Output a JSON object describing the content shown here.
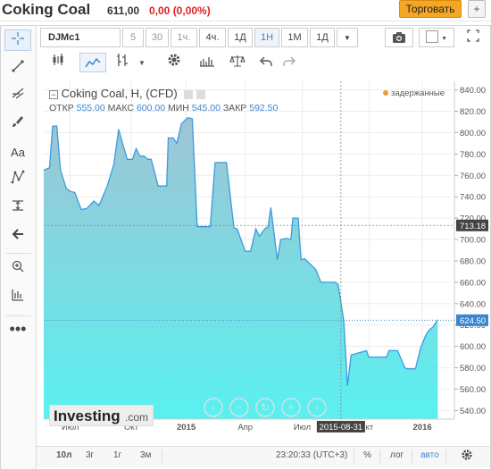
{
  "header": {
    "title": "Coking Coal",
    "price": "611,00",
    "change": "0,00 (0,00%)",
    "trade_label": "Торговать",
    "add_portfolio_label": "+",
    "change_color": "#e0201f"
  },
  "toolbar_top": {
    "symbol": "DJMc1",
    "intervals": [
      "5",
      "30",
      "1ч.",
      "4ч.",
      "1Д",
      "1Н",
      "1М",
      "1Д"
    ],
    "active_interval": "1Н"
  },
  "toolbar_second": {
    "icons": [
      "bars-icon",
      "area-chart-icon",
      "candles-icon",
      "dropdown-icon",
      "gear-icon",
      "indicators-icon",
      "compare-icon",
      "undo-icon",
      "redo-icon"
    ]
  },
  "left_tools": [
    "crosshair-icon",
    "line-tool-icon",
    "fib-tool-icon",
    "brush-icon",
    "text-tool-icon",
    "pattern-tool-icon",
    "measure-tool-icon",
    "arrow-icon",
    "zoom-icon",
    "indicator-tool-icon",
    "more-icon"
  ],
  "left_tool_text": "Aa",
  "chart_info": {
    "name": "Coking Coal, H, (CFD)",
    "open_label": "ОТКР",
    "open": "555.00",
    "high_label": "МАКС",
    "high": "600.00",
    "low_label": "МИН",
    "low": "545.00",
    "close_label": "ЗАКР",
    "close": "592.50",
    "delayed_label": "задержанные"
  },
  "logo": {
    "word": "Investing",
    "suffix": ".com"
  },
  "bottom_bar": {
    "ranges": [
      "10л",
      "3г",
      "1г",
      "3м"
    ],
    "time": "23:20:33 (UTC+3)",
    "percent": "%",
    "log": "лог",
    "auto": "авто"
  },
  "chart_data": {
    "type": "area",
    "yticks": [
      540,
      560,
      580,
      600,
      620,
      640,
      660,
      680,
      700,
      720,
      740,
      760,
      780,
      800,
      820,
      840
    ],
    "ytick_labels": [
      "540.00",
      "560.00",
      "580.00",
      "600.00",
      "620.00",
      "640.00",
      "660.00",
      "680.00",
      "700.00",
      "720.00",
      "740.00",
      "760.00",
      "780.00",
      "800.00",
      "820.00",
      "840.00"
    ],
    "ylim": [
      532,
      848
    ],
    "xlim": [
      0,
      100
    ],
    "xlabels": [
      {
        "x": 6.5,
        "label": "Июл"
      },
      {
        "x": 21.5,
        "label": "Окт"
      },
      {
        "x": 35,
        "label": "2015"
      },
      {
        "x": 49.5,
        "label": "Апр"
      },
      {
        "x": 63.5,
        "label": "Июл"
      },
      {
        "x": 73,
        "label": "2015-08-31",
        "highlight": true
      },
      {
        "x": 80,
        "label": "кт"
      },
      {
        "x": 93,
        "label": "2016"
      }
    ],
    "series": [
      {
        "x": [
          0,
          1.4,
          2.2,
          3.2,
          4.1,
          5.5,
          6.5,
          7.6,
          9.2,
          10.6,
          12.3,
          13.6,
          15.6,
          17.2,
          18.4,
          19.2,
          20.5,
          21.8,
          22.7,
          23.6,
          24.6,
          25.6,
          26.4,
          28.1,
          28.6,
          30.2,
          30.6,
          31.8,
          32.7,
          33.8,
          35.3,
          36.5,
          37.7,
          38.2,
          40.1,
          40.9,
          42.1,
          42.9,
          44.1,
          44.9,
          46.7,
          47.5,
          49.5,
          50.8,
          52.1,
          53,
          54.3,
          55.1,
          55.8,
          57.4,
          58.2,
          59.7,
          60.7,
          61.2,
          62.5,
          63.2,
          64.1,
          66.8,
          68.1,
          69.2,
          69.6,
          71.5,
          72.3,
          73.7,
          74.6,
          75.5,
          79.3,
          79.8,
          84.2,
          84.8,
          86.9,
          88.7,
          89.2,
          91.3,
          92.6,
          93.8,
          94.6,
          95.6,
          96.3,
          96.8
        ],
        "values": [
          765,
          767,
          806,
          806,
          765,
          748,
          745,
          744,
          728,
          729,
          736,
          732,
          750,
          770,
          803,
          792,
          775,
          775,
          785,
          778,
          778,
          775,
          775,
          750,
          750,
          750,
          795,
          795,
          790,
          808,
          814,
          813,
          712,
          712,
          712,
          712,
          772,
          772,
          772,
          772,
          711,
          710,
          689,
          689,
          710,
          703,
          710,
          712,
          730,
          681,
          700,
          701,
          700,
          720,
          720,
          681,
          682,
          672,
          660,
          660,
          660,
          660,
          658,
          624,
          563,
          592,
          596,
          590,
          590,
          596,
          596,
          580,
          579,
          579,
          599,
          610,
          615,
          618,
          622,
          625
        ]
      }
    ],
    "price_marker": {
      "value": 624.5,
      "label": "624.50"
    },
    "crosshair": {
      "value": 713.18,
      "label": "713.18",
      "x": 73
    },
    "colors": {
      "line": "#3a9be0",
      "fill_top": "#9fc4d4",
      "fill_bottom": "#5af0f0",
      "grid": "#ececec"
    }
  }
}
